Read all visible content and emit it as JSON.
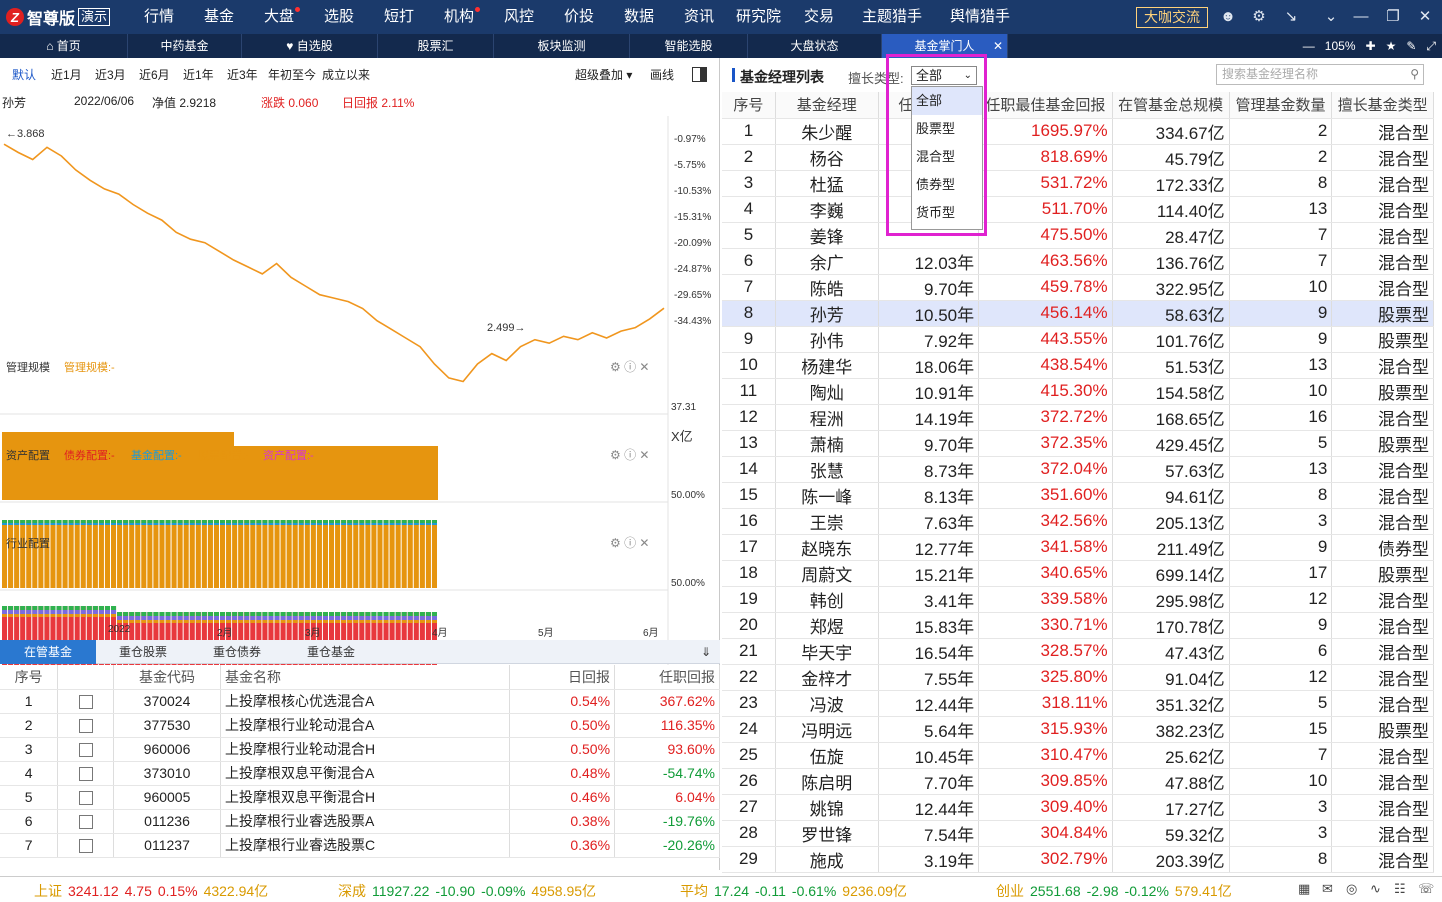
{
  "topbar": {
    "logo_mark": "Z",
    "logo_text": "智尊版",
    "logo_badge": "演示",
    "menu": [
      "行情",
      "基金",
      "大盘",
      "选股",
      "短打",
      "机构",
      "风控",
      "价投",
      "数据",
      "资讯",
      "研究院",
      "交易",
      "主题猎手",
      "舆情猎手"
    ],
    "menu_dots": [
      "大盘",
      "机构"
    ],
    "cta": "大咖交流"
  },
  "tabs": {
    "items": [
      "首页",
      "中药基金",
      "自选股",
      "股票汇",
      "板块监测",
      "智能选股",
      "大盘状态",
      "基金掌门人"
    ],
    "active": "基金掌门人",
    "zoom": "105%"
  },
  "left": {
    "ranges": [
      "默认",
      "近1月",
      "近3月",
      "近6月",
      "近1年",
      "近3年",
      "年初至今",
      "成立以来"
    ],
    "overlay": "超级叠加",
    "draw": "画线",
    "info": {
      "name": "孙芳",
      "date": "2022/06/06",
      "nav": "净值 2.9218",
      "change": "涨跌 0.060",
      "daily": "日回报 2.11%"
    },
    "nav_high": "3.868",
    "nav_low": "2.499",
    "right_ticks": [
      "-0.97%",
      "-5.75%",
      "-10.53%",
      "-15.31%",
      "-20.09%",
      "-24.87%",
      "-29.65%",
      "-34.43%"
    ],
    "scale_label": "管理规模",
    "scale_value_label": "管理规模:-",
    "scale_tick": "37.31",
    "scale_unit": "X亿",
    "asset_label": "资产配置",
    "asset_legend": [
      "债券配置:-",
      "基金配置:-",
      "股票配置:-",
      "资产配置:-"
    ],
    "asset_tick": "50.00%",
    "industry_label": "行业配置",
    "industry_tick": "50.00%",
    "x_ticks": [
      "2022",
      "2月",
      "3月",
      "4月",
      "5月",
      "6月"
    ],
    "bottom_tabs": [
      "在管基金",
      "重仓股票",
      "重仓债券",
      "重仓基金"
    ],
    "table_headers": [
      "序号",
      "",
      "基金代码",
      "基金名称",
      "日回报",
      "任职回报"
    ],
    "rows": [
      [
        "1",
        "370024",
        "上投摩根核心优选混合A",
        "0.54%",
        "367.62%"
      ],
      [
        "2",
        "377530",
        "上投摩根行业轮动混合A",
        "0.50%",
        "116.35%"
      ],
      [
        "3",
        "960006",
        "上投摩根行业轮动混合H",
        "0.50%",
        "93.60%"
      ],
      [
        "4",
        "373010",
        "上投摩根双息平衡混合A",
        "0.48%",
        "-54.74%"
      ],
      [
        "5",
        "960005",
        "上投摩根双息平衡混合H",
        "0.46%",
        "6.04%"
      ],
      [
        "6",
        "011236",
        "上投摩根行业睿选股票A",
        "0.38%",
        "-19.76%"
      ],
      [
        "7",
        "011237",
        "上投摩根行业睿选股票C",
        "0.36%",
        "-20.26%"
      ]
    ]
  },
  "chart_data": {
    "type": "line",
    "title": "",
    "x": [
      "2022",
      "2月",
      "3月",
      "4月",
      "5月",
      "6月"
    ],
    "series": [
      {
        "values": [
          3.868,
          3.82,
          3.78,
          3.85,
          3.8,
          3.72,
          3.66,
          3.61,
          3.58,
          3.52,
          3.47,
          3.43,
          3.36,
          3.32,
          3.3,
          3.25,
          3.2,
          3.16,
          3.12,
          3.18,
          3.1,
          3.05,
          3.0,
          2.98,
          2.96,
          2.92,
          2.85,
          2.8,
          2.75,
          2.7,
          2.6,
          2.52,
          2.499,
          2.6,
          2.66,
          2.62,
          2.7,
          2.74,
          2.72,
          2.76,
          2.74,
          2.78,
          2.75,
          2.79,
          2.81,
          2.86,
          2.9218
        ]
      }
    ],
    "ylim": [
      2.45,
      3.95
    ],
    "annotations": [
      "3.868",
      "2.499"
    ]
  },
  "right": {
    "title": "基金经理列表",
    "filter_label": "擅长类型:",
    "filter_value": "全部",
    "filter_options": [
      "全部",
      "股票型",
      "混合型",
      "债券型",
      "货币型"
    ],
    "search_placeholder": "搜索基金经理名称",
    "headers": [
      "序号",
      "基金经理",
      "任职年限",
      "任职最佳基金回报",
      "在管基金总规模",
      "管理基金数量",
      "擅长基金类型"
    ],
    "selected_row": 8,
    "rows": [
      [
        "1",
        "朱少醒",
        "",
        "1695.97%",
        "334.67亿",
        "2",
        "混合型"
      ],
      [
        "2",
        "杨谷",
        "",
        "818.69%",
        "45.79亿",
        "2",
        "混合型"
      ],
      [
        "3",
        "杜猛",
        "",
        "531.72%",
        "172.33亿",
        "8",
        "混合型"
      ],
      [
        "4",
        "李巍",
        "",
        "511.70%",
        "114.40亿",
        "13",
        "混合型"
      ],
      [
        "5",
        "姜锋",
        "",
        "475.50%",
        "28.47亿",
        "7",
        "混合型"
      ],
      [
        "6",
        "余广",
        "12.03年",
        "463.56%",
        "136.76亿",
        "7",
        "混合型"
      ],
      [
        "7",
        "陈皓",
        "9.70年",
        "459.78%",
        "322.95亿",
        "10",
        "混合型"
      ],
      [
        "8",
        "孙芳",
        "10.50年",
        "456.14%",
        "58.63亿",
        "9",
        "股票型"
      ],
      [
        "9",
        "孙伟",
        "7.92年",
        "443.55%",
        "101.76亿",
        "9",
        "股票型"
      ],
      [
        "10",
        "杨建华",
        "18.06年",
        "438.54%",
        "51.53亿",
        "13",
        "混合型"
      ],
      [
        "11",
        "陶灿",
        "10.91年",
        "415.30%",
        "154.58亿",
        "10",
        "股票型"
      ],
      [
        "12",
        "程洲",
        "14.19年",
        "372.72%",
        "168.65亿",
        "16",
        "混合型"
      ],
      [
        "13",
        "萧楠",
        "9.70年",
        "372.35%",
        "429.45亿",
        "5",
        "股票型"
      ],
      [
        "14",
        "张慧",
        "8.73年",
        "372.04%",
        "57.63亿",
        "13",
        "混合型"
      ],
      [
        "15",
        "陈一峰",
        "8.13年",
        "351.60%",
        "94.61亿",
        "8",
        "混合型"
      ],
      [
        "16",
        "王崇",
        "7.63年",
        "342.56%",
        "205.13亿",
        "3",
        "混合型"
      ],
      [
        "17",
        "赵晓东",
        "12.77年",
        "341.58%",
        "211.49亿",
        "9",
        "债券型"
      ],
      [
        "18",
        "周蔚文",
        "15.21年",
        "340.65%",
        "699.14亿",
        "17",
        "股票型"
      ],
      [
        "19",
        "韩创",
        "3.41年",
        "339.58%",
        "295.98亿",
        "12",
        "混合型"
      ],
      [
        "20",
        "郑煜",
        "15.83年",
        "330.71%",
        "170.78亿",
        "9",
        "混合型"
      ],
      [
        "21",
        "毕天宇",
        "16.54年",
        "328.57%",
        "47.43亿",
        "6",
        "混合型"
      ],
      [
        "22",
        "金梓才",
        "7.55年",
        "325.80%",
        "91.04亿",
        "12",
        "混合型"
      ],
      [
        "23",
        "冯波",
        "12.44年",
        "318.11%",
        "351.32亿",
        "5",
        "混合型"
      ],
      [
        "24",
        "冯明远",
        "5.64年",
        "315.93%",
        "382.23亿",
        "15",
        "股票型"
      ],
      [
        "25",
        "伍旋",
        "10.45年",
        "310.47%",
        "25.62亿",
        "7",
        "混合型"
      ],
      [
        "26",
        "陈启明",
        "7.70年",
        "309.85%",
        "47.88亿",
        "10",
        "混合型"
      ],
      [
        "27",
        "姚锦",
        "12.44年",
        "309.40%",
        "17.27亿",
        "3",
        "混合型"
      ],
      [
        "28",
        "罗世锋",
        "7.54年",
        "304.84%",
        "59.32亿",
        "3",
        "混合型"
      ],
      [
        "29",
        "施成",
        "3.19年",
        "302.79%",
        "203.39亿",
        "8",
        "混合型"
      ]
    ]
  },
  "status": [
    {
      "name": "上证",
      "value": "3241.12",
      "chg": "4.75",
      "pct": "0.15%",
      "amt": "4322.94亿",
      "dir": "up"
    },
    {
      "name": "深成",
      "value": "11927.22",
      "chg": "-10.90",
      "pct": "-0.09%",
      "amt": "4958.95亿",
      "dir": "down"
    },
    {
      "name": "平均",
      "value": "17.24",
      "chg": "-0.11",
      "pct": "-0.61%",
      "amt": "9236.09亿",
      "dir": "down"
    },
    {
      "name": "创业",
      "value": "2551.68",
      "chg": "-2.98",
      "pct": "-0.12%",
      "amt": "579.41亿",
      "dir": "down"
    }
  ],
  "colors": {
    "accent": "#1a56c8",
    "up": "#e02020",
    "down": "#109b37",
    "line": "#f0961e",
    "highlight": "#e022d0",
    "bar": "#e6950f"
  }
}
